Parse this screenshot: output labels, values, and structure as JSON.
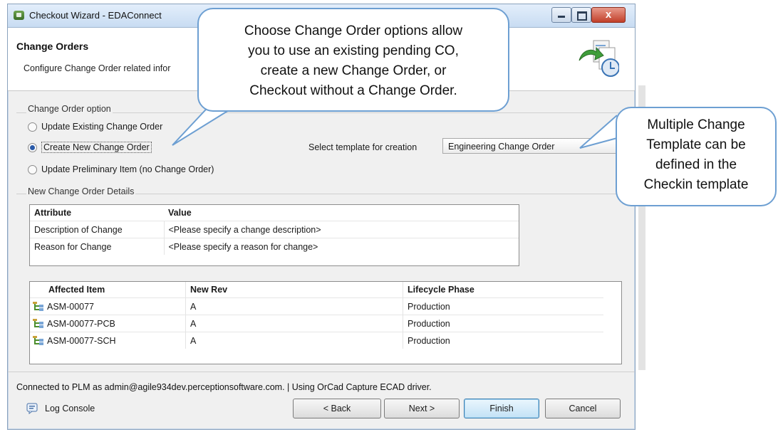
{
  "window": {
    "title": "Checkout Wizard - EDAConnect",
    "close_label": "x"
  },
  "header": {
    "title": "Change Orders",
    "description": "Configure Change Order related infor"
  },
  "change_order_option": {
    "legend": "Change Order option",
    "options": [
      {
        "label": "Update Existing Change Order",
        "selected": false
      },
      {
        "label": "Create New Change Order",
        "selected": true
      },
      {
        "label": "Update Preliminary Item (no Change Order)",
        "selected": false
      }
    ],
    "template_label": "Select template for creation",
    "template_value": "Engineering Change Order"
  },
  "details": {
    "legend": "New Change Order Details",
    "columns": [
      "Attribute",
      "Value"
    ],
    "rows": [
      [
        "Description of Change",
        "<Please specify a change description>"
      ],
      [
        "Reason for Change",
        "<Please specify a reason for change>"
      ]
    ]
  },
  "affected_items": {
    "columns": [
      "Affected Item",
      "New Rev",
      "Lifecycle Phase"
    ],
    "rows": [
      [
        "ASM-00077",
        "A",
        "Production"
      ],
      [
        "ASM-00077-PCB",
        "A",
        "Production"
      ],
      [
        "ASM-00077-SCH",
        "A",
        "Production"
      ]
    ]
  },
  "status": "Connected to PLM as admin@agile934dev.perceptionsoftware.com.  | Using OrCad Capture ECAD driver.",
  "footer": {
    "log_console": "Log Console",
    "back": "< Back",
    "next": "Next >",
    "finish": "Finish",
    "cancel": "Cancel"
  },
  "callouts": {
    "options_note": [
      "Choose Change Order options allow",
      "you to use an existing pending CO,",
      "create a new Change Order, or",
      "Checkout without a Change Order."
    ],
    "template_note": [
      "Multiple Change",
      "Template can be",
      "defined in the",
      "Checkin template"
    ]
  },
  "colors": {
    "callout_border": "#6d9fd2",
    "selected_radio": "#2a5aa8",
    "finish_border": "#3c7fb1"
  }
}
